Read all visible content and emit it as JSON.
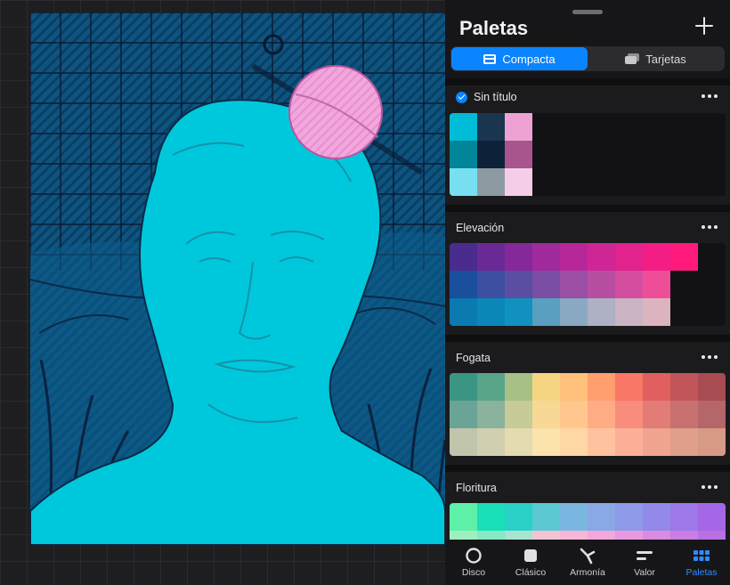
{
  "panel": {
    "title": "Paletas",
    "segments": [
      {
        "label": "Compacta",
        "active": true,
        "icon": "compact-icon"
      },
      {
        "label": "Tarjetas",
        "active": false,
        "icon": "cards-icon"
      }
    ]
  },
  "palettes": [
    {
      "name": "Sin título",
      "default": true,
      "rows": [
        [
          "#00bcd6",
          "#1a3550",
          "#eea2d4",
          "",
          "",
          "",
          "",
          "",
          "",
          ""
        ],
        [
          "#008599",
          "#0d2238",
          "#a8548d",
          "",
          "",
          "",
          "",
          "",
          "",
          ""
        ],
        [
          "#76e0f0",
          "#8e9aa2",
          "#f6cde9",
          "",
          "",
          "",
          "",
          "",
          "",
          ""
        ]
      ]
    },
    {
      "name": "Elevación",
      "default": false,
      "rows": [
        [
          "#4a2c8e",
          "#6a2a96",
          "#85299a",
          "#a0299c",
          "#b8279a",
          "#cf2595",
          "#e2228d",
          "#f21e85",
          "#ff1a7c",
          ""
        ],
        [
          "#1a4f9e",
          "#3c4fa0",
          "#5a4ea2",
          "#7a4ea4",
          "#9a4ea4",
          "#b84ea2",
          "#d34e9e",
          "#ee4e98",
          "",
          ""
        ],
        [
          "#0a7ab0",
          "#0b86b8",
          "#1191bf",
          "#5a9fc0",
          "#8aa9c3",
          "#aeb0c4",
          "#cab3c2",
          "#dbb4bf",
          "",
          ""
        ]
      ]
    },
    {
      "name": "Fogata",
      "default": false,
      "rows": [
        [
          "#3a9683",
          "#58a58a",
          "#a6c086",
          "#f6d582",
          "#ffc07a",
          "#ff9e6e",
          "#f97766",
          "#e06060",
          "#c0565a",
          "#a94c52"
        ],
        [
          "#6aa496",
          "#8bb29a",
          "#c6cb98",
          "#f8d895",
          "#ffc78e",
          "#ffac85",
          "#f98c7d",
          "#e37b76",
          "#c97070",
          "#b56669"
        ],
        [
          "#c0c5ac",
          "#d0cfb0",
          "#e4dbb0",
          "#fbe3ac",
          "#ffd6a5",
          "#ffc29e",
          "#fdb097",
          "#efa590",
          "#e09f8a",
          "#d69a86"
        ]
      ]
    },
    {
      "name": "Floritura",
      "default": false,
      "rows": [
        [
          "#5ef0a8",
          "#18dfb8",
          "#29d1c6",
          "#5cc8d4",
          "#7ab7e0",
          "#8aa8e6",
          "#8e9ae8",
          "#9289e8",
          "#9c78e8",
          "#a468e6"
        ],
        [
          "#9cf0c0",
          "#86e8c4",
          "#a8e4cf",
          "#f2c4d2",
          "#f6b6d6",
          "#f2a8da",
          "#e89ade",
          "#d98ce0",
          "#c87ee2",
          "#b870e2"
        ]
      ]
    }
  ],
  "tabs": [
    {
      "label": "Disco",
      "icon": "disc-icon",
      "active": false
    },
    {
      "label": "Clásico",
      "icon": "classic-icon",
      "active": false
    },
    {
      "label": "Armonía",
      "icon": "harmony-icon",
      "active": false
    },
    {
      "label": "Valor",
      "icon": "value-icon",
      "active": false
    },
    {
      "label": "Paletas",
      "icon": "palettes-icon",
      "active": true
    }
  ],
  "colors": {
    "accent": "#0a84ff",
    "canvas_background": "#0c5b87",
    "bust": "#00c8dc",
    "planet": "#f0a0d8"
  }
}
